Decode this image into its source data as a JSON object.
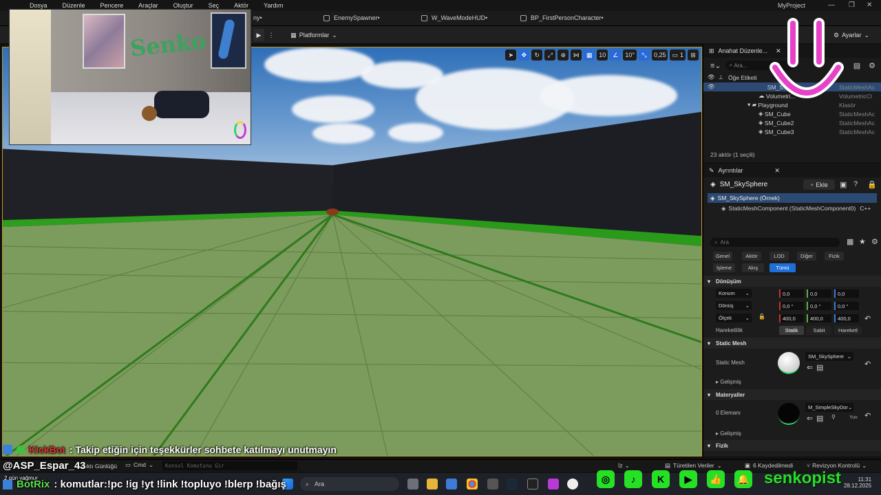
{
  "menu": {
    "items": [
      "Dosya",
      "Düzenle",
      "Pencere",
      "Araçlar",
      "Oluştur",
      "Seç",
      "Aktör",
      "Yardım"
    ],
    "project": "MyProject"
  },
  "tabs": [
    "ny•",
    "EnemySpawner•",
    "W_WaveModeHUD•",
    "BP_FirstPersonCharacter•"
  ],
  "toolbar": {
    "platforms": "Platformlar",
    "settings": "Ayarlar"
  },
  "viewport_tools": {
    "grid_size": "10",
    "angle": "10°",
    "scale": "0,25",
    "camera_speed": "1"
  },
  "outliner": {
    "title": "Anahat Düzenle...",
    "search_placeholder": "Ara...",
    "column_label": "Öğe Etiketi",
    "rows": [
      {
        "label": "SM_S...",
        "type": "StaticMeshAc"
      },
      {
        "label": "Volumetri...",
        "type": "VolumetricCl"
      },
      {
        "label": "Playground",
        "type": "Klasör"
      },
      {
        "label": "SM_Cube",
        "type": "StaticMeshAc"
      },
      {
        "label": "SM_Cube2",
        "type": "StaticMeshAc"
      },
      {
        "label": "SM_Cube3",
        "type": "StaticMeshAc"
      }
    ],
    "footer": "23 aktör (1 seçili)"
  },
  "details": {
    "title": "Ayrıntılar",
    "actor_name": "SM_SkySphere",
    "add_label": "Ekle",
    "instance": "SM_SkySphere (Örnek)",
    "component": "StaticMeshComponent (StaticMeshComponent0)",
    "component_tag": "C++",
    "search_placeholder": "Ara",
    "categories_row1": [
      "Genel",
      "Aktör",
      "LOD",
      "Diğer",
      "Fizik"
    ],
    "categories_row2": [
      "İşleme",
      "Akış",
      "Tümü"
    ],
    "transform_section": "Dönüşüm",
    "location_label": "Konum",
    "location": [
      "0,0",
      "0,0",
      "0,0"
    ],
    "rotation_label": "Dönüş",
    "rotation": [
      "0,0 °",
      "0,0 °",
      "0,0 °"
    ],
    "scale_label": "Ölçek",
    "scale": [
      "400,0",
      "400,0",
      "400,0"
    ],
    "mobility_label": "Hareketlilik",
    "mobility": [
      "Statik",
      "Sabit",
      "Hareketl"
    ],
    "static_mesh_section": "Static Mesh",
    "static_mesh_label": "Static Mesh",
    "static_mesh_value": "SM_SkySphere",
    "advanced_label": "Gelişmiş",
    "materials_section": "Materyaller",
    "element_label": "0 Elemanı",
    "material_value": "M_SimpleSkyDor",
    "material_sub": "Yuv",
    "advanced2_label": "Gelişmiş",
    "physics_section": "Fizik"
  },
  "statusbar": {
    "output_log": "Çıktı Günlüğü",
    "cmd": "Cmd",
    "console_placeholder": "Konsol Komutunu Gir",
    "derived": "Türetilen Veriler",
    "saved": "6 Kaydedilmedi",
    "revision": "Revizyon Kontrolü",
    "trace": "İz"
  },
  "taskbar": {
    "search": "Ara",
    "time": "11:31",
    "date": "28.12.2025"
  },
  "chat": {
    "line1_user": "KickBot",
    "line1_text": ": Takip etiğin için teşekkürler sohbete katılmayı unutmayın",
    "line2_user": "@ASP_Espar_43",
    "line3_user": "BotRix",
    "line3_text": ": komutlar:!pc !ig !yt !link !topluyo !blerp !bağış",
    "small_note": "2 gün yağmur"
  },
  "social": {
    "handle": "senkopist"
  },
  "webcam": {
    "wall_text": "Senko"
  },
  "colors": {
    "accent": "#2a6ad6",
    "selected": "#2c4a73",
    "viewport_border": "#c69b2a",
    "social_green": "#26e026",
    "chat_user_red": "#e03030",
    "floor": "#7a9a5c"
  }
}
